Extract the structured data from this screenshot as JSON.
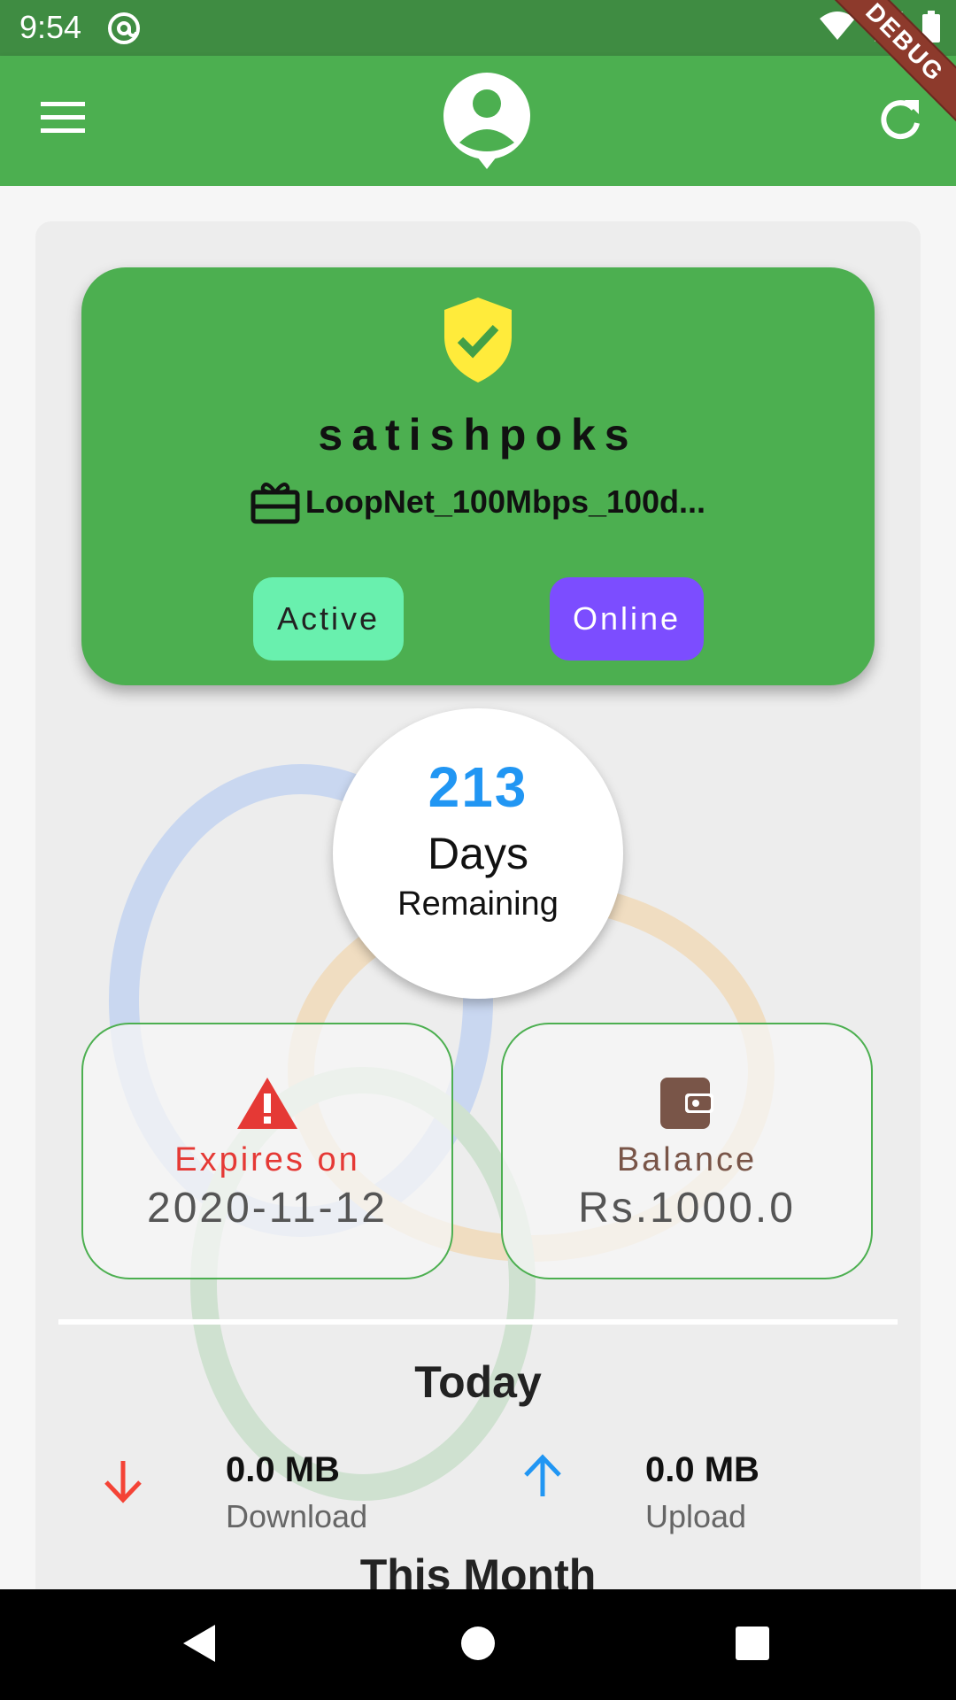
{
  "status_bar": {
    "time": "9:54"
  },
  "debug_banner": "DEBUG",
  "profile": {
    "username": "satishpoks",
    "package": "LoopNet_100Mbps_100d...",
    "status_active": "Active",
    "status_online": "Online"
  },
  "days": {
    "count": "213",
    "unit": "Days",
    "label": "Remaining"
  },
  "expiry": {
    "label": "Expires on",
    "value": "2020-11-12"
  },
  "balance": {
    "label": "Balance",
    "value": "Rs.1000.0"
  },
  "today": {
    "title": "Today",
    "download": {
      "value": "0.0 MB",
      "label": "Download"
    },
    "upload": {
      "value": "0.0 MB",
      "label": "Upload"
    }
  },
  "next_section_title": "This Month",
  "colors": {
    "appbar": "#4caf50",
    "status_bar": "#3f8c42",
    "active_pill": "#69f0ae",
    "online_pill": "#7c4dff",
    "days": "#2196f3",
    "expiry": "#e53935",
    "balance": "#795548",
    "download_arrow": "#f44336",
    "upload_arrow": "#2196f3"
  },
  "icons": [
    "menu-icon",
    "avatar-icon",
    "refresh-icon",
    "shield-check-icon",
    "gift-card-icon",
    "warning-icon",
    "wallet-icon",
    "arrow-down-icon",
    "arrow-up-icon"
  ]
}
